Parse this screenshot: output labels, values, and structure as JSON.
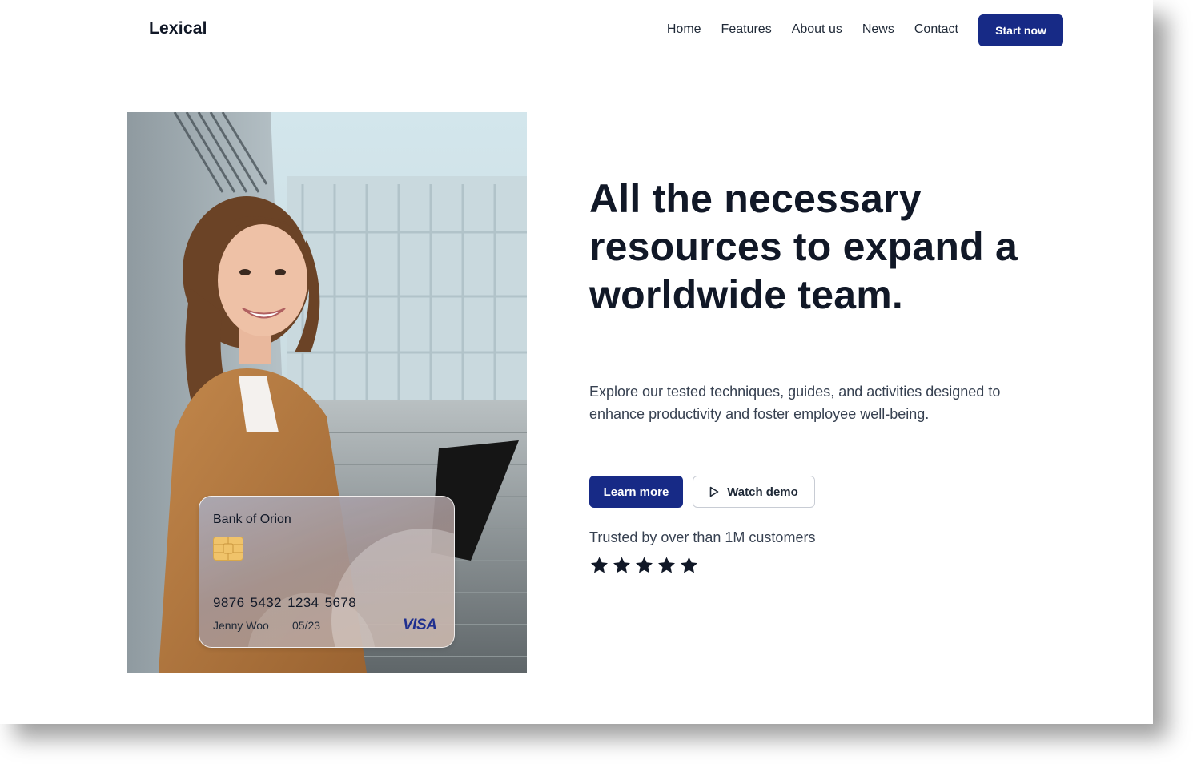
{
  "header": {
    "logo": "Lexical",
    "nav": [
      "Home",
      "Features",
      "About us",
      "News",
      "Contact"
    ],
    "cta_label": "Start now"
  },
  "hero": {
    "headline": "All the necessary resources to expand a worldwide team.",
    "subtext": "Explore our tested techniques, guides, and activities designed to enhance productivity and foster employee well-being.",
    "primary_button": "Learn more",
    "secondary_button": "Watch demo",
    "secondary_icon": "play-icon",
    "trusted_text": "Trusted by over than 1M customers",
    "rating": {
      "value": 5,
      "max": 5,
      "icon": "star-icon"
    }
  },
  "card": {
    "bank": "Bank of Orion",
    "number": "9876  5432  1234  5678",
    "holder": "Jenny Woo",
    "expiry": "05/23",
    "brand": "VISA",
    "chip_icon": "chip-icon"
  },
  "photo": {
    "subject": "woman-with-laptop-photo"
  },
  "colors": {
    "primary": "#172a86",
    "text": "#111827",
    "muted": "#374151"
  }
}
